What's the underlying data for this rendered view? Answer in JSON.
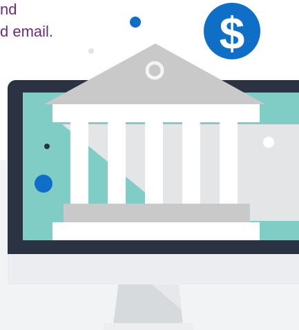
{
  "text_lines": [
    "nd",
    "d email."
  ],
  "icons": {
    "dollar_badge": "dollar-sign-icon",
    "bank": "bank-building-icon",
    "monitor": "desktop-monitor-icon"
  },
  "colors": {
    "purple_text": "#6b2d73",
    "blue_accent": "#0f6fc6",
    "teal_screen": "#7fcdc5",
    "monitor_frame": "#2b3242",
    "bank_gray": "#c9c9c9",
    "dot_dark": "#2b3242"
  }
}
